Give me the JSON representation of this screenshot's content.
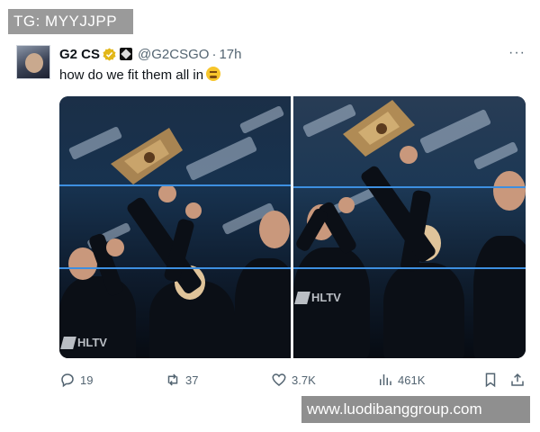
{
  "watermark_top": "TG: MYYJJPP",
  "watermark_bottom": "www.luodibanggroup.com",
  "tweet": {
    "display_name": "G2 CS",
    "handle": "@G2CSGO",
    "separator": "·",
    "time": "17h",
    "text": "how do we fit them all in",
    "more_label": "···"
  },
  "media": {
    "left_logo": "HLTV",
    "right_logo": "HLTV"
  },
  "actions": {
    "replies": "19",
    "reposts": "37",
    "likes": "3.7K",
    "views": "461K"
  },
  "icons": {
    "verified": "gold-verified-badge-icon",
    "affiliate": "g2-affiliate-badge-icon",
    "emoji": "weary-face-emoji-icon",
    "reply": "reply-icon",
    "repost": "repost-icon",
    "like": "heart-icon",
    "views": "views-chart-icon",
    "bookmark": "bookmark-icon",
    "share": "share-icon"
  },
  "colors": {
    "text": "#0f1419",
    "muted": "#536471",
    "crop_line": "#3d8fe0",
    "verified_gold": "#e2b719"
  }
}
